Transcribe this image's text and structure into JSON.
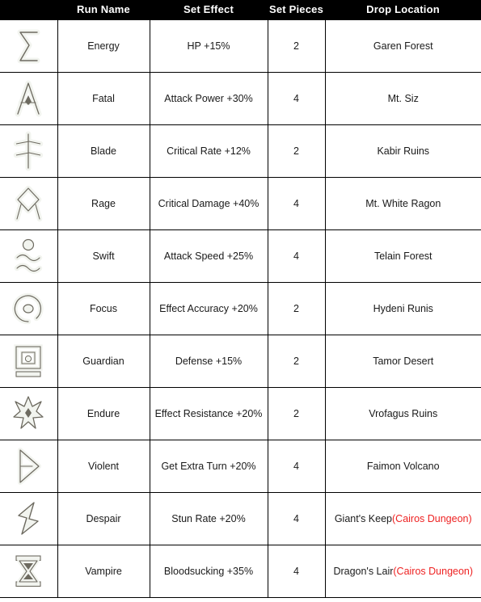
{
  "table": {
    "headers": {
      "icon": "",
      "run_name": "Run Name",
      "set_effect": "Set Effect",
      "set_pieces": "Set Pieces",
      "drop_location": "Drop Location"
    },
    "accent_red": "#ee2222",
    "header_bg": "#000000",
    "header_fg": "#ffffff",
    "rows": [
      {
        "icon": "energy-rune-icon",
        "name": "Energy",
        "effect": "HP +15%",
        "pieces": "2",
        "drop": "Garen Forest",
        "drop_note": ""
      },
      {
        "icon": "fatal-rune-icon",
        "name": "Fatal",
        "effect": "Attack Power +30%",
        "pieces": "4",
        "drop": "Mt. Siz",
        "drop_note": ""
      },
      {
        "icon": "blade-rune-icon",
        "name": "Blade",
        "effect": "Critical Rate +12%",
        "pieces": "2",
        "drop": "Kabir Ruins",
        "drop_note": ""
      },
      {
        "icon": "rage-rune-icon",
        "name": "Rage",
        "effect": "Critical Damage +40%",
        "pieces": "4",
        "drop": "Mt. White Ragon",
        "drop_note": ""
      },
      {
        "icon": "swift-rune-icon",
        "name": "Swift",
        "effect": "Attack Speed +25%",
        "pieces": "4",
        "drop": "Telain Forest",
        "drop_note": ""
      },
      {
        "icon": "focus-rune-icon",
        "name": "Focus",
        "effect": "Effect Accuracy +20%",
        "pieces": "2",
        "drop": "Hydeni Runis",
        "drop_note": ""
      },
      {
        "icon": "guardian-rune-icon",
        "name": "Guardian",
        "effect": "Defense +15%",
        "pieces": "2",
        "drop": "Tamor Desert",
        "drop_note": ""
      },
      {
        "icon": "endure-rune-icon",
        "name": "Endure",
        "effect": "Effect Resistance +20%",
        "pieces": "2",
        "drop": "Vrofagus Ruins",
        "drop_note": ""
      },
      {
        "icon": "violent-rune-icon",
        "name": "Violent",
        "effect": "Get Extra Turn +20%",
        "pieces": "4",
        "drop": "Faimon Volcano",
        "drop_note": ""
      },
      {
        "icon": "despair-rune-icon",
        "name": "Despair",
        "effect": "Stun Rate +20%",
        "pieces": "4",
        "drop": "Giant's Keep",
        "drop_note": "(Cairos Dungeon)"
      },
      {
        "icon": "vampire-rune-icon",
        "name": "Vampire",
        "effect": "Bloodsucking +35%",
        "pieces": "4",
        "drop": "Dragon's Lair",
        "drop_note": "(Cairos Dungeon)"
      }
    ]
  }
}
